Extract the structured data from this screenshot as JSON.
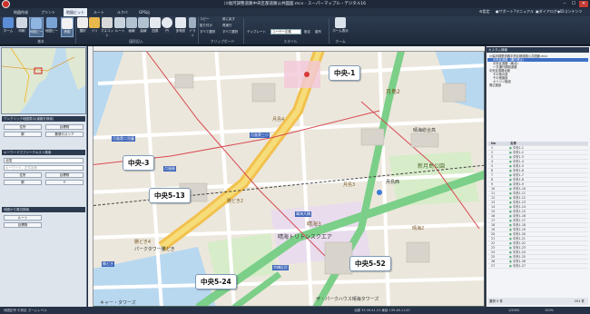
{
  "app": {
    "title": "川幅河調整道路中央区都道路公共図面.mcv - スーパーマップル・デジタル16",
    "window_controls": [
      "‒",
      "☐",
      "✕"
    ]
  },
  "tabs": [
    {
      "label": "地図作成",
      "active": false
    },
    {
      "label": "プリント",
      "active": false
    },
    {
      "label": "地図ビット",
      "active": true
    },
    {
      "label": "ルート",
      "active": false
    },
    {
      "label": "ルクバ",
      "active": false
    },
    {
      "label": "GPS出",
      "active": false
    }
  ],
  "right_links": [
    "設定",
    "サポート",
    "マニュアル",
    "ダイアログ",
    "IDコンテンツ"
  ],
  "ribbon": {
    "buttons": [
      {
        "label": "ホーム"
      },
      {
        "label": "印刷"
      },
      {
        "label": "地図ビー"
      },
      {
        "label": "地図ビー"
      },
      {
        "label": "移動"
      },
      {
        "label": "選択"
      },
      {
        "label": "ツリ"
      },
      {
        "label": "マスコット"
      },
      {
        "label": "ルート"
      },
      {
        "label": "画線"
      },
      {
        "label": "曲線"
      },
      {
        "label": "四角"
      },
      {
        "label": "円"
      },
      {
        "label": "多角形"
      },
      {
        "label": "ドライ"
      }
    ],
    "small_buttons": [
      "コピー",
      "貼り付け",
      "すべて選択",
      "前に戻す",
      "再実行",
      "すべて選択"
    ],
    "template_label": "テンプレート",
    "template_value": "ユーザー定義",
    "style_button": "設定",
    "copy_style_button": "複写",
    "home_button": "ホーム表示",
    "groups": [
      "基本",
      "図形記入",
      "クリップボード",
      "スタイル",
      "ホーム"
    ]
  },
  "left_panel": {
    "section1_title": "ワンクリック地図表示(道路を検索)",
    "section1_buttons": [
      "住所",
      "目標物",
      "駅",
      "郵便ロスリア"
    ],
    "section2_title": "キーワードでフリーテキスト検索",
    "section2_select": "全国",
    "section2_placeholder": "キーワード、正式名称",
    "section2_buttons": [
      "住所",
      "目標物",
      "駅",
      "〒"
    ],
    "section3_title": "地図から周辺検索",
    "section3_items": [
      "ルート",
      "目標物"
    ]
  },
  "map": {
    "callouts": [
      "中央-1",
      "中央-3",
      "中央5-13",
      "中央5-24",
      "中央5-52"
    ],
    "labels": [
      "月島2",
      "月島4",
      "月島3",
      "新月島公園",
      "晴海総合高",
      "月島西",
      "月島第二児童",
      "月島第三小",
      "勝どき2",
      "勝どき4",
      "晴海2",
      "晴海トリトンスクエア",
      "晴海3",
      "パークタワー勝どき",
      "ザ・パークハウス晴海タワーズ",
      "キャー・タワーズ",
      "月島駅",
      "勝どき",
      "京橋区民",
      "晴海大橋"
    ]
  },
  "right_panel": {
    "title": "カスタム情報",
    "tree_items": [
      "川幅河調整道路中央区都道路公共図面.mcv",
      "中央区道路（通行禁止）",
      "中央区道路（南北）",
      "一方通行規制道路",
      "中央区道路台帳",
      "その他の道",
      "その他施設",
      "オリジン施設",
      "周辺施設"
    ],
    "grid_header": [
      "No",
      "名称"
    ],
    "grid_rows": [
      {
        "no": "1",
        "name": "中央1-1"
      },
      {
        "no": "2",
        "name": "中央1-2"
      },
      {
        "no": "3",
        "name": "中央1-3"
      },
      {
        "no": "4",
        "name": "中央1-4"
      },
      {
        "no": "5",
        "name": "中央1-5"
      },
      {
        "no": "6",
        "name": "中央1-6"
      },
      {
        "no": "7",
        "name": "中央1-7"
      },
      {
        "no": "8",
        "name": "中央1-8"
      },
      {
        "no": "9",
        "name": "中央1-9"
      },
      {
        "no": "10",
        "name": "中央1-10"
      },
      {
        "no": "11",
        "name": "中央1-11"
      },
      {
        "no": "12",
        "name": "中央1-12"
      },
      {
        "no": "13",
        "name": "中央1-13"
      },
      {
        "no": "14",
        "name": "中央1-14"
      },
      {
        "no": "15",
        "name": "中央1-15"
      },
      {
        "no": "16",
        "name": "中央1-16"
      },
      {
        "no": "17",
        "name": "中央1-17"
      },
      {
        "no": "18",
        "name": "中央1-18"
      },
      {
        "no": "19",
        "name": "中央1-19"
      },
      {
        "no": "20",
        "name": "中央1-20"
      },
      {
        "no": "21",
        "name": "中央1-21"
      },
      {
        "no": "22",
        "name": "中央1-22"
      },
      {
        "no": "23",
        "name": "中央1-23"
      },
      {
        "no": "24",
        "name": "中央1-24"
      },
      {
        "no": "25",
        "name": "中央1-25"
      },
      {
        "no": "26",
        "name": "中央1-26"
      },
      {
        "no": "27",
        "name": "中央1-27"
      }
    ],
    "footer_count": "選択 0 件",
    "footer_total": "151 件"
  },
  "status": {
    "left": "地図記号 中央区 ズームレベル",
    "coords": "北緯 35.39.41.13  東経 139.46.11.67",
    "scale": "1/5000",
    "zoom": "100%"
  }
}
